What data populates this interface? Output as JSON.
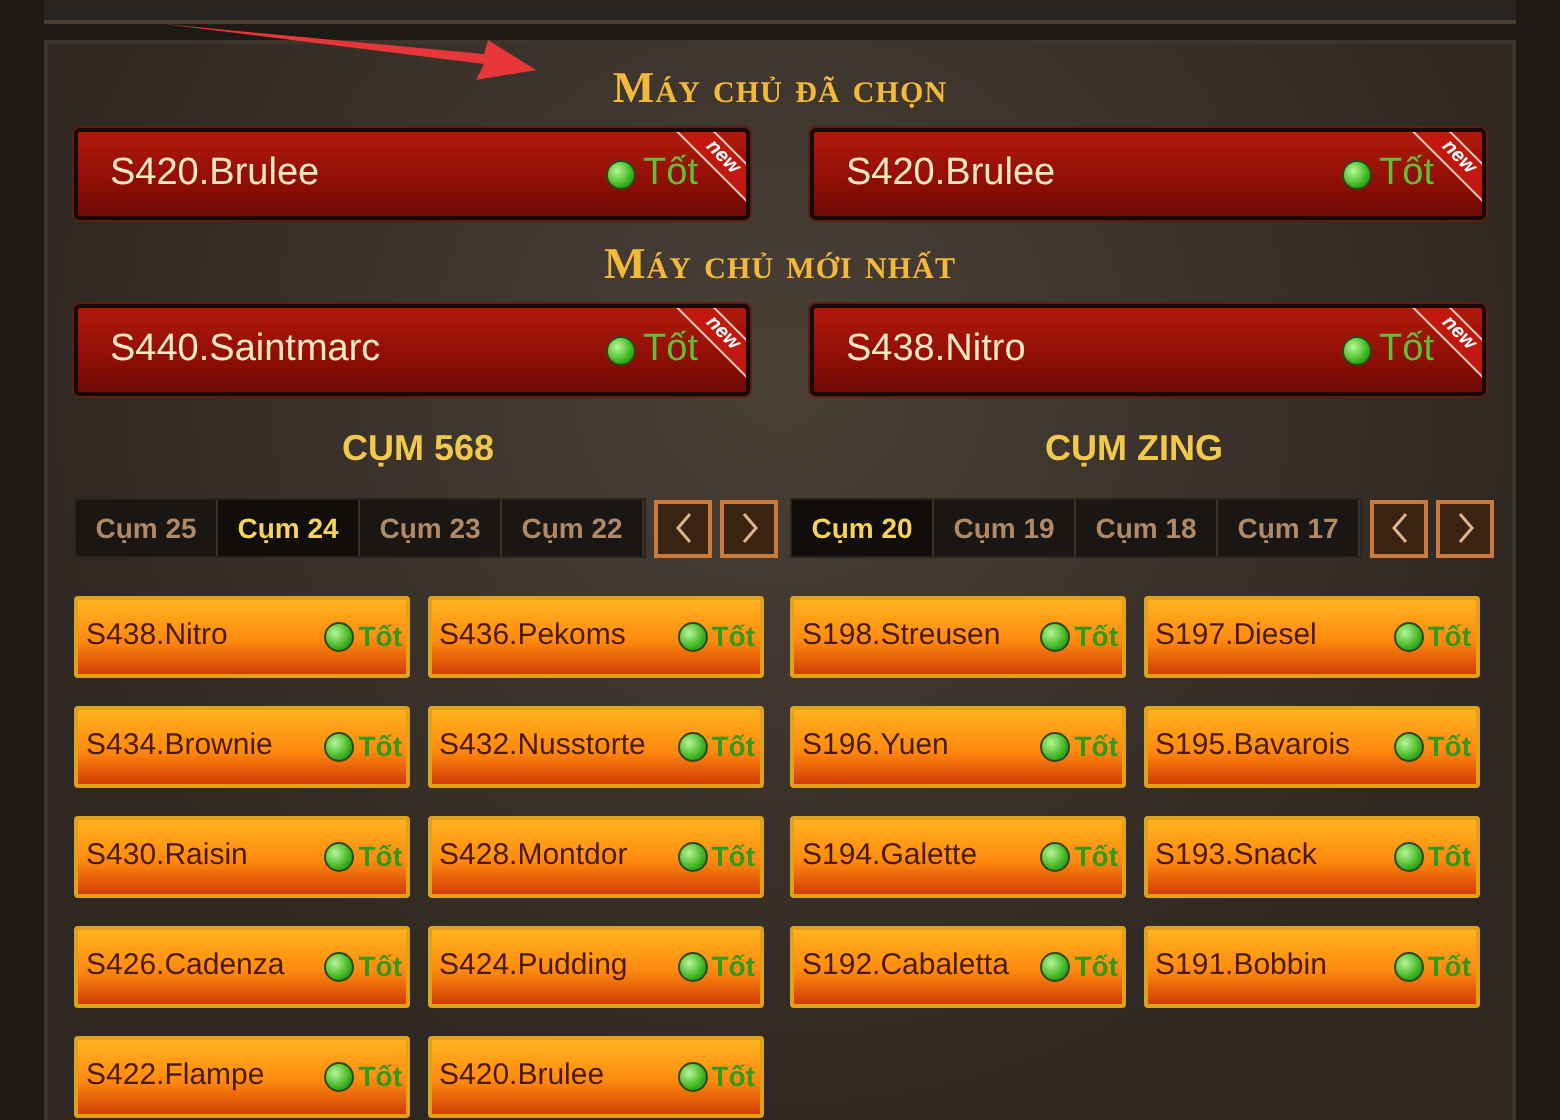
{
  "sections": [
    {
      "title": "Máy chủ đã chọn",
      "servers": [
        {
          "name": "S420.Brulee",
          "status": "Tốt",
          "badge": "new"
        },
        {
          "name": "S420.Brulee",
          "status": "Tốt",
          "badge": "new"
        }
      ]
    },
    {
      "title": "Máy chủ mới nhất",
      "servers": [
        {
          "name": "S440.Saintmarc",
          "status": "Tốt",
          "badge": "new"
        },
        {
          "name": "S438.Nitro",
          "status": "Tốt",
          "badge": "new"
        }
      ]
    }
  ],
  "clusters": [
    {
      "title": "CỤM 568",
      "tabs": [
        {
          "label": "Cụm 25",
          "selected": false
        },
        {
          "label": "Cụm 24",
          "selected": true
        },
        {
          "label": "Cụm 23",
          "selected": false
        },
        {
          "label": "Cụm 22",
          "selected": false
        }
      ],
      "servers": [
        {
          "name": "S438.Nitro",
          "status": "Tốt"
        },
        {
          "name": "S436.Pekoms",
          "status": "Tốt"
        },
        {
          "name": "S434.Brownie",
          "status": "Tốt"
        },
        {
          "name": "S432.Nusstorte",
          "status": "Tốt"
        },
        {
          "name": "S430.Raisin",
          "status": "Tốt"
        },
        {
          "name": "S428.Montdor",
          "status": "Tốt"
        },
        {
          "name": "S426.Cadenza",
          "status": "Tốt"
        },
        {
          "name": "S424.Pudding",
          "status": "Tốt"
        },
        {
          "name": "S422.Flampe",
          "status": "Tốt"
        },
        {
          "name": "S420.Brulee",
          "status": "Tốt"
        }
      ]
    },
    {
      "title": "CỤM ZING",
      "tabs": [
        {
          "label": "Cụm 20",
          "selected": true
        },
        {
          "label": "Cụm 19",
          "selected": false
        },
        {
          "label": "Cụm 18",
          "selected": false
        },
        {
          "label": "Cụm 17",
          "selected": false
        }
      ],
      "servers": [
        {
          "name": "S198.Streusen",
          "status": "Tốt"
        },
        {
          "name": "S197.Diesel",
          "status": "Tốt"
        },
        {
          "name": "S196.Yuen",
          "status": "Tốt"
        },
        {
          "name": "S195.Bavarois",
          "status": "Tốt"
        },
        {
          "name": "S194.Galette",
          "status": "Tốt"
        },
        {
          "name": "S193.Snack",
          "status": "Tốt"
        },
        {
          "name": "S192.Cabaletta",
          "status": "Tốt"
        },
        {
          "name": "S191.Bobbin",
          "status": "Tốt"
        }
      ]
    }
  ]
}
